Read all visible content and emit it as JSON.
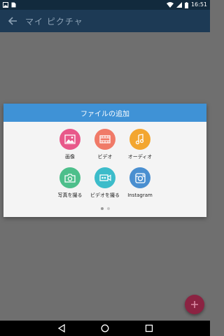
{
  "status_bar": {
    "time": "16:51"
  },
  "app_bar": {
    "title": "マイ ピクチャ"
  },
  "dialog": {
    "title": "ファイルの追加",
    "items": [
      {
        "label": "画像",
        "icon": "image-icon",
        "color": "#e8588a"
      },
      {
        "label": "ビデオ",
        "icon": "video-icon",
        "color": "#f07a68"
      },
      {
        "label": "オーディオ",
        "icon": "music-note-icon",
        "color": "#f3a630"
      },
      {
        "label": "写真を撮る",
        "icon": "camera-icon",
        "color": "#4dbf8b"
      },
      {
        "label": "ビデオを撮る",
        "icon": "video-camera-icon",
        "color": "#3cbcca"
      },
      {
        "label": "Instagram",
        "icon": "instagram-icon",
        "color": "#4a8fd0"
      }
    ],
    "page_indicator": {
      "pages": 2,
      "current": 1
    }
  },
  "fab": {
    "icon": "plus-icon",
    "color": "#8b2342"
  }
}
